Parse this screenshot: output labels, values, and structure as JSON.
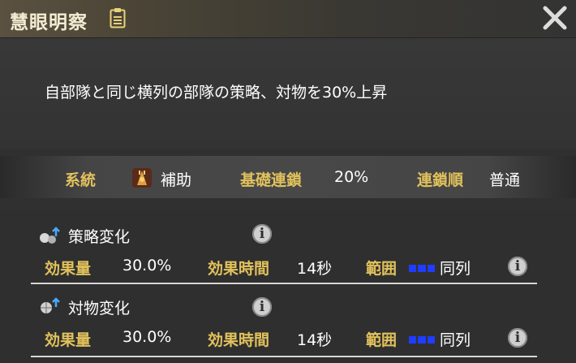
{
  "dialog": {
    "title": "慧眼明察",
    "description": "自部隊と同じ横列の部隊の策略、対物を30%上昇"
  },
  "info": {
    "lineage_label": "系統",
    "lineage_value": "補助",
    "base_chain_label": "基礎連鎖",
    "base_chain_value": "20%",
    "chain_order_label": "連鎖順",
    "chain_order_value": "普通"
  },
  "effects": [
    {
      "name": "策略変化",
      "amount_label": "効果量",
      "amount_value": "30.0%",
      "duration_label": "効果時間",
      "duration_value": "14秒",
      "range_label": "範囲",
      "range_value": "同列"
    },
    {
      "name": "対物変化",
      "amount_label": "効果量",
      "amount_value": "30.0%",
      "duration_label": "効果時間",
      "duration_value": "14秒",
      "range_label": "範囲",
      "range_value": "同列"
    }
  ],
  "colors": {
    "label_gold": "#e2c25c",
    "range_blue": "#1f3cff",
    "text_white": "#ffffff"
  },
  "icons": {
    "clipboard": "clipboard-icon",
    "close": "close-icon",
    "support": "support-icon",
    "strategy": "strategy-change-icon",
    "siege": "siege-change-icon",
    "info": "info-icon"
  }
}
